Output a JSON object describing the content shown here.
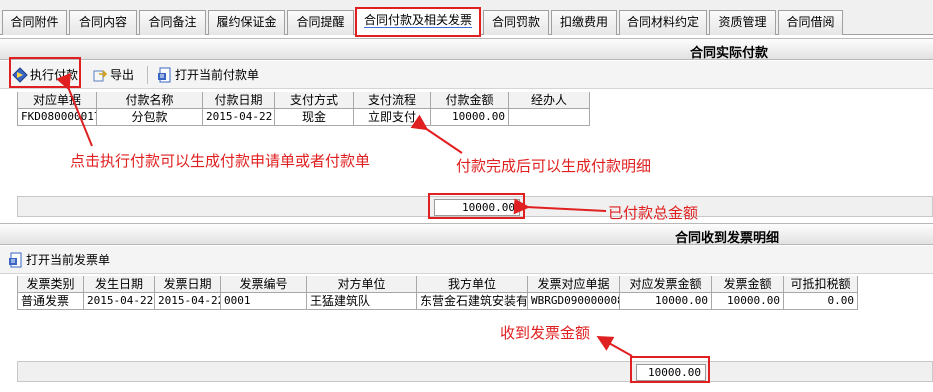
{
  "tabs": [
    {
      "label": "合同附件"
    },
    {
      "label": "合同内容"
    },
    {
      "label": "合同备注"
    },
    {
      "label": "履约保证金"
    },
    {
      "label": "合同提醒"
    },
    {
      "label": "合同付款及相关发票",
      "active": true
    },
    {
      "label": "合同罚款"
    },
    {
      "label": "扣缴费用"
    },
    {
      "label": "合同材料约定"
    },
    {
      "label": "资质管理"
    },
    {
      "label": "合同借阅"
    }
  ],
  "payment": {
    "title": "合同实际付款",
    "toolbar": {
      "execute": "执行付款",
      "export": "导出",
      "open": "打开当前付款单"
    },
    "columns": [
      "对应单据",
      "付款名称",
      "付款日期",
      "支付方式",
      "支付流程",
      "付款金额",
      "经办人"
    ],
    "rows": [
      {
        "doc": "FKD080000017",
        "name": "分包款",
        "date": "2015-04-22",
        "method": "现金",
        "flow": "立即支付",
        "amount": "10000.00",
        "handler": ""
      }
    ],
    "total": "10000.00"
  },
  "invoice": {
    "title": "合同收到发票明细",
    "toolbar": {
      "open": "打开当前发票单"
    },
    "columns": [
      "发票类别",
      "发生日期",
      "发票日期",
      "发票编号",
      "对方单位",
      "我方单位",
      "发票对应单据",
      "对应发票金额",
      "发票金额",
      "可抵扣税额"
    ],
    "rows": [
      {
        "type": "普通发票",
        "occur": "2015-04-22",
        "inv_date": "2015-04-22",
        "number": "0001",
        "counterparty": "王猛建筑队",
        "our_unit": "东营金石建筑安装有",
        "doc": "WBRGD090000008",
        "match_amount": "10000.00",
        "amount": "10000.00",
        "tax": "0.00"
      }
    ],
    "total": "10000.00"
  },
  "annotations": {
    "a1": "点击执行付款可以生成付款申请单或者付款单",
    "a2": "付款完成后可以生成付款明细",
    "a3": "已付款总金额",
    "a4": "收到发票金额"
  },
  "colors": {
    "accent_red": "#e02020",
    "tab_underline": "#3c6fd8"
  },
  "icons": {
    "execute": "diamond-arrow-icon",
    "export": "export-icon",
    "open": "document-icon"
  }
}
